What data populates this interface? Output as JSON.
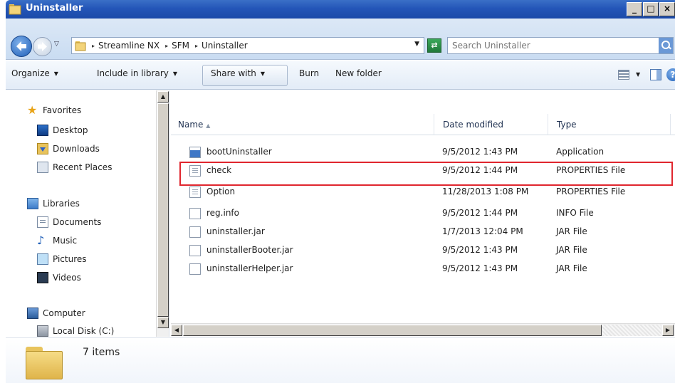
{
  "window": {
    "title": "Uninstaller",
    "controls": [
      "_",
      "□",
      "×"
    ]
  },
  "address": {
    "crumbs": [
      "Streamline NX",
      "SFM",
      "Uninstaller"
    ],
    "search_placeholder": "Search Uninstaller"
  },
  "toolbar": {
    "organize": "Organize",
    "include": "Include in library",
    "share": "Share with",
    "burn": "Burn",
    "new_folder": "New folder"
  },
  "nav": {
    "favorites": "Favorites",
    "desktop": "Desktop",
    "downloads": "Downloads",
    "recent": "Recent Places",
    "libraries": "Libraries",
    "documents": "Documents",
    "music": "Music",
    "pictures": "Pictures",
    "videos": "Videos",
    "computer": "Computer",
    "local_disk": "Local Disk (C:)"
  },
  "columns": {
    "name": "Name",
    "date": "Date modified",
    "type": "Type"
  },
  "files": [
    {
      "name": "bootUninstaller",
      "date": "9/5/2012 1:43 PM",
      "type": "Application",
      "icon": "application-icon"
    },
    {
      "name": "check",
      "date": "9/5/2012 1:44 PM",
      "type": "PROPERTIES File",
      "icon": "properties-file-icon"
    },
    {
      "name": "Option",
      "date": "11/28/2013 1:08 PM",
      "type": "PROPERTIES File",
      "icon": "properties-file-icon"
    },
    {
      "name": "reg.info",
      "date": "9/5/2012 1:44 PM",
      "type": "INFO File",
      "icon": "file-icon"
    },
    {
      "name": "uninstaller.jar",
      "date": "1/7/2013 12:04 PM",
      "type": "JAR File",
      "icon": "file-icon"
    },
    {
      "name": "uninstallerBooter.jar",
      "date": "9/5/2012 1:43 PM",
      "type": "JAR File",
      "icon": "file-icon"
    },
    {
      "name": "uninstallerHelper.jar",
      "date": "9/5/2012 1:43 PM",
      "type": "JAR File",
      "icon": "file-icon"
    }
  ],
  "status": {
    "count": "7 items"
  },
  "colors": {
    "highlight": "#e0262e",
    "titlebar": "#2456b8"
  }
}
